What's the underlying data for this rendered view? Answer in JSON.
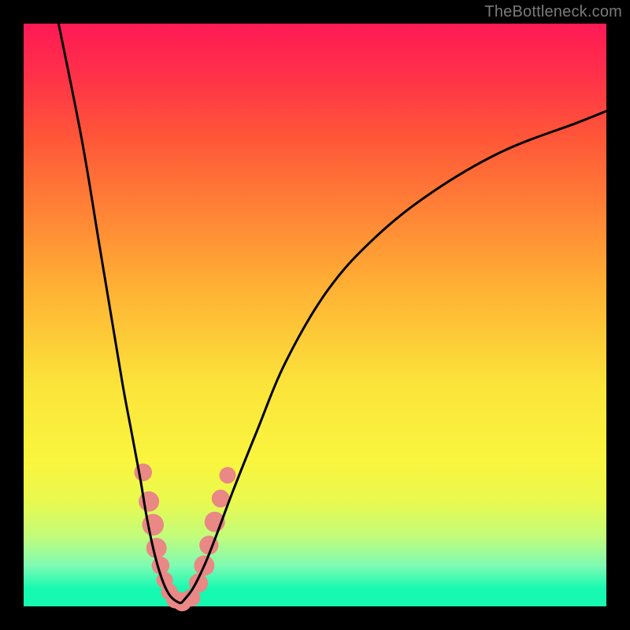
{
  "attribution": "TheBottleneck.com",
  "colors": {
    "gradient_top": "#ff1a55",
    "gradient_mid": "#fbe43a",
    "gradient_bottom": "#16f9b1",
    "curve": "#000000",
    "markers": "#e98885",
    "frame": "#000000"
  },
  "chart_data": {
    "type": "line",
    "title": "",
    "xlabel": "",
    "ylabel": "",
    "xlim": [
      0,
      100
    ],
    "ylim": [
      0,
      100
    ],
    "series": [
      {
        "name": "left-curve",
        "x": [
          6,
          10,
          13,
          15,
          17,
          18.5,
          20,
          21,
          22,
          23,
          24,
          25,
          26,
          27
        ],
        "y": [
          100,
          80,
          62,
          50,
          38,
          30,
          22,
          16,
          11,
          7,
          4,
          2,
          1,
          0.5
        ]
      },
      {
        "name": "right-curve",
        "x": [
          27,
          29,
          31,
          33,
          36,
          40,
          45,
          52,
          60,
          70,
          82,
          95,
          100
        ],
        "y": [
          0.5,
          3,
          7,
          12,
          20,
          30,
          42,
          54,
          63,
          71,
          78,
          83,
          85
        ]
      }
    ],
    "markers": [
      {
        "x": 20.5,
        "y": 23,
        "r": 1.8
      },
      {
        "x": 21.5,
        "y": 18,
        "r": 2.2
      },
      {
        "x": 22.2,
        "y": 14,
        "r": 2.4
      },
      {
        "x": 22.8,
        "y": 10,
        "r": 2.2
      },
      {
        "x": 23.5,
        "y": 7,
        "r": 1.8
      },
      {
        "x": 24.2,
        "y": 4.5,
        "r": 1.6
      },
      {
        "x": 25.0,
        "y": 2.5,
        "r": 1.6
      },
      {
        "x": 26.0,
        "y": 1.2,
        "r": 1.8
      },
      {
        "x": 27.2,
        "y": 0.8,
        "r": 2.0
      },
      {
        "x": 28.8,
        "y": 1.5,
        "r": 1.8
      },
      {
        "x": 30.0,
        "y": 4.0,
        "r": 2.0
      },
      {
        "x": 31.0,
        "y": 7.0,
        "r": 2.2
      },
      {
        "x": 31.8,
        "y": 10.5,
        "r": 2.0
      },
      {
        "x": 32.8,
        "y": 14.5,
        "r": 2.2
      },
      {
        "x": 33.8,
        "y": 18.5,
        "r": 1.8
      },
      {
        "x": 35.0,
        "y": 22.5,
        "r": 1.6
      }
    ]
  }
}
